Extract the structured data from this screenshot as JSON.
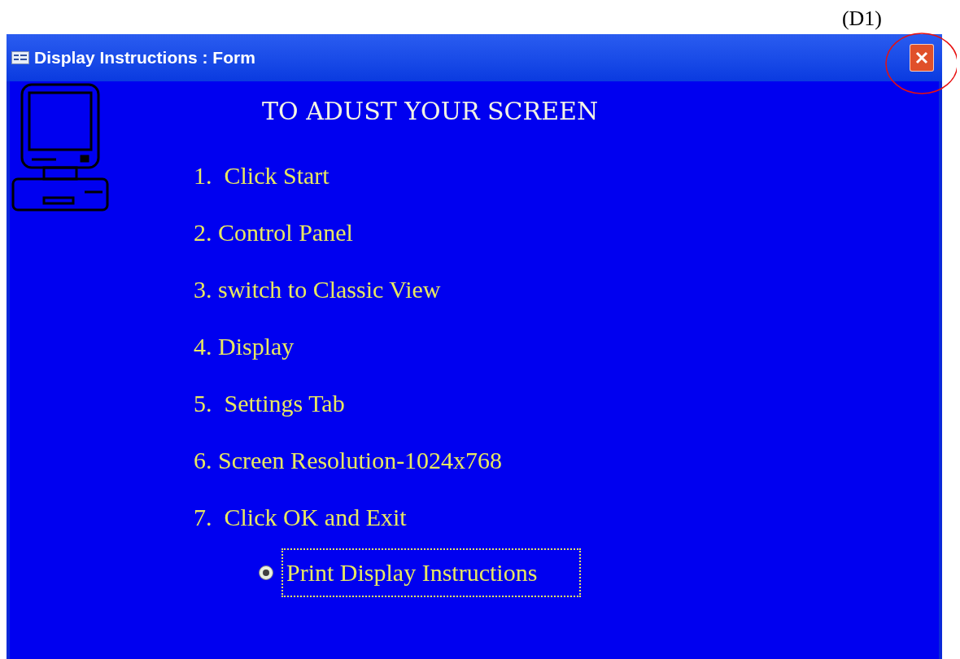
{
  "annotation": {
    "label": "(D1)"
  },
  "window": {
    "title": "Display Instructions : Form"
  },
  "heading": "TO ADUST YOUR SCREEN",
  "steps": [
    "1.  Click Start",
    "2. Control Panel",
    "3. switch to Classic View",
    "4. Display",
    "5.  Settings Tab",
    "6. Screen Resolution-1024x768",
    "7.  Click OK and Exit"
  ],
  "print_option": {
    "label": "Print Display Instructions",
    "selected": true
  }
}
